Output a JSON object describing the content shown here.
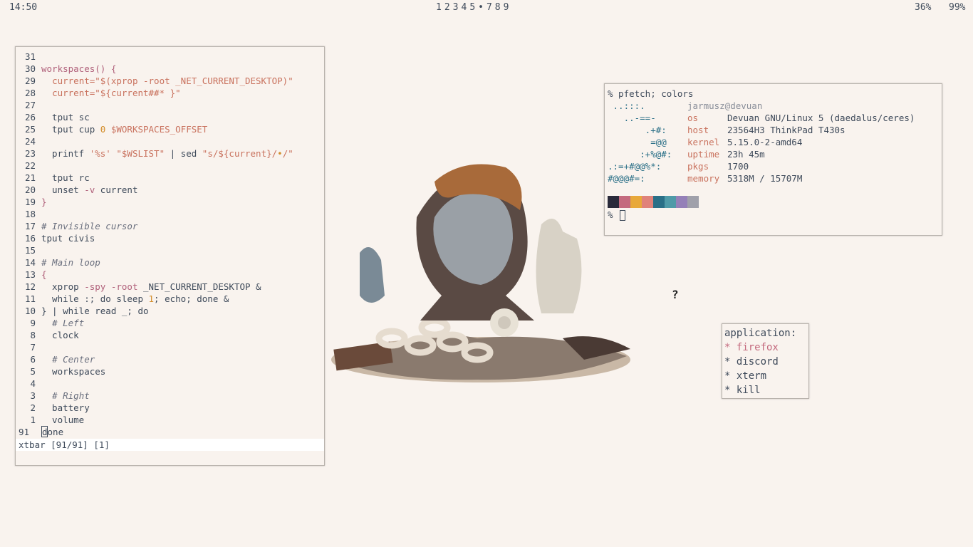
{
  "bar": {
    "clock": "14:50",
    "workspaces": [
      "1",
      "2",
      "3",
      "4",
      "5",
      "•",
      "7",
      "8",
      "9"
    ],
    "battery": "36%",
    "volume": "99%"
  },
  "editor": {
    "lines": [
      {
        "n": "31",
        "code": []
      },
      {
        "n": "30",
        "code": [
          [
            "kw",
            "workspaces() {"
          ]
        ]
      },
      {
        "n": "29",
        "code": [
          [
            "",
            "  "
          ],
          [
            "str",
            "current=\"$(xprop -root _NET_CURRENT_DESKTOP)\""
          ]
        ]
      },
      {
        "n": "28",
        "code": [
          [
            "",
            "  "
          ],
          [
            "str",
            "current=\"${current##* }\""
          ]
        ]
      },
      {
        "n": "27",
        "code": []
      },
      {
        "n": "26",
        "code": [
          [
            "",
            "  tput sc"
          ]
        ]
      },
      {
        "n": "25",
        "code": [
          [
            "",
            "  tput cup "
          ],
          [
            "numlit",
            "0"
          ],
          [
            "var",
            " $WORKSPACES_OFFSET"
          ]
        ]
      },
      {
        "n": "24",
        "code": []
      },
      {
        "n": "23",
        "code": [
          [
            "",
            "  printf "
          ],
          [
            "str",
            "'%s'"
          ],
          [
            "",
            " "
          ],
          [
            "str",
            "\"$WSLIST\""
          ],
          [
            "",
            " | sed "
          ],
          [
            "str",
            "\"s/${current}/"
          ],
          [
            "numlit",
            "•"
          ],
          [
            "str",
            "/\""
          ]
        ]
      },
      {
        "n": "22",
        "code": []
      },
      {
        "n": "21",
        "code": [
          [
            "",
            "  tput rc"
          ]
        ]
      },
      {
        "n": "20",
        "code": [
          [
            "",
            "  unset "
          ],
          [
            "kw",
            "-v"
          ],
          [
            "",
            " current"
          ]
        ]
      },
      {
        "n": "19",
        "code": [
          [
            "kw",
            "}"
          ]
        ]
      },
      {
        "n": "18",
        "code": []
      },
      {
        "n": "17",
        "code": [
          [
            "cm",
            "# Invisible cursor"
          ]
        ]
      },
      {
        "n": "16",
        "code": [
          [
            "",
            "tput civis"
          ]
        ]
      },
      {
        "n": "15",
        "code": []
      },
      {
        "n": "14",
        "code": [
          [
            "cm",
            "# Main loop"
          ]
        ]
      },
      {
        "n": "13",
        "code": [
          [
            "kw",
            "{"
          ]
        ]
      },
      {
        "n": "12",
        "code": [
          [
            "",
            "  xprop "
          ],
          [
            "kw",
            "-spy -root"
          ],
          [
            "",
            " _NET_CURRENT_DESKTOP &"
          ]
        ]
      },
      {
        "n": "11",
        "code": [
          [
            "",
            "  while :; do sleep "
          ],
          [
            "numlit",
            "1"
          ],
          [
            "",
            ";"
          ],
          [
            "",
            " echo; done &"
          ]
        ]
      },
      {
        "n": "10",
        "code": [
          [
            "",
            "} | while read _; do"
          ]
        ]
      },
      {
        "n": "9",
        "code": [
          [
            "",
            "  "
          ],
          [
            "cm",
            "# Left"
          ]
        ]
      },
      {
        "n": "8",
        "code": [
          [
            "",
            "  clock"
          ]
        ]
      },
      {
        "n": "7",
        "code": []
      },
      {
        "n": "6",
        "code": [
          [
            "",
            "  "
          ],
          [
            "cm",
            "# Center"
          ]
        ]
      },
      {
        "n": "5",
        "code": [
          [
            "",
            "  workspaces"
          ]
        ]
      },
      {
        "n": "4",
        "code": []
      },
      {
        "n": "3",
        "code": [
          [
            "",
            "  "
          ],
          [
            "cm",
            "# Right"
          ]
        ]
      },
      {
        "n": "2",
        "code": [
          [
            "",
            "  battery"
          ]
        ]
      },
      {
        "n": "1",
        "code": [
          [
            "",
            "  volume"
          ]
        ]
      },
      {
        "n": "91",
        "code": [
          [
            "cursor",
            "d"
          ],
          [
            "",
            "done"
          ]
        ],
        "current": true
      }
    ],
    "status": "xtbar [91/91] [1]"
  },
  "terminal": {
    "prompt_cmd": "% pfetch; colors",
    "user": "jarmusz@devuan",
    "logo": [
      " ..:::.",
      "   ..-==-",
      "       .+#:",
      "        =@@",
      "      :+%@#:",
      ".:=+#@@%*:",
      "#@@@#=:"
    ],
    "fields": [
      {
        "label": "os",
        "value": "Devuan GNU/Linux 5 (daedalus/ceres)"
      },
      {
        "label": "host",
        "value": "23564H3 ThinkPad T430s"
      },
      {
        "label": "kernel",
        "value": "5.15.0-2-amd64"
      },
      {
        "label": "uptime",
        "value": "23h 45m"
      },
      {
        "label": "pkgs",
        "value": "1700"
      },
      {
        "label": "memory",
        "value": "5318M / 15707M"
      }
    ],
    "swatches": [
      "#2a2a3a",
      "#c46a7e",
      "#e8a83a",
      "#e0827a",
      "#2a6f87",
      "#4f9aa8",
      "#9580b8",
      "#a0a0aa"
    ],
    "prompt": "%"
  },
  "menu": {
    "title": "application:",
    "items": [
      "* firefox",
      "* discord",
      "* xterm",
      "* kill"
    ]
  },
  "pointer": "?"
}
